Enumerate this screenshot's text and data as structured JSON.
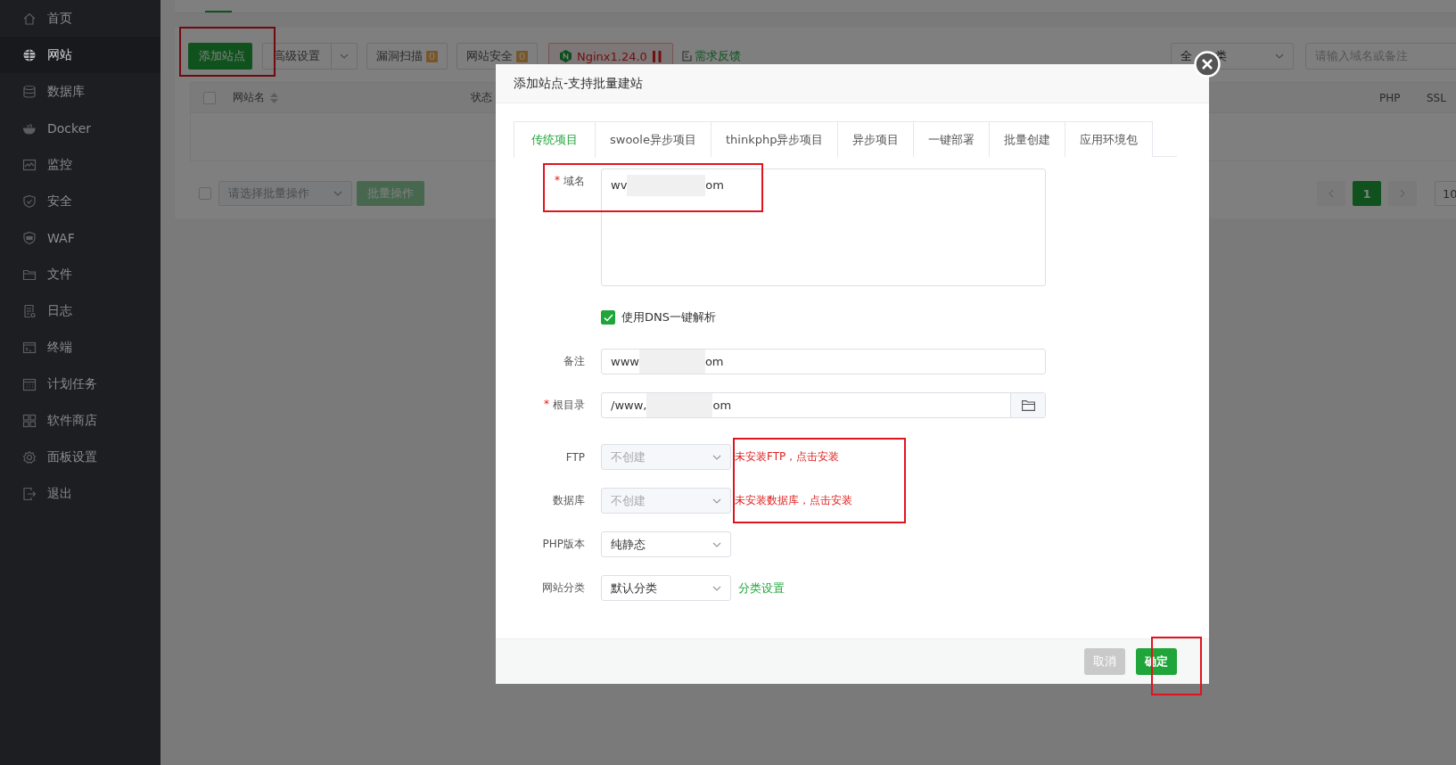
{
  "sidebar": {
    "items": [
      {
        "label": "首页",
        "selected": false
      },
      {
        "label": "网站",
        "selected": true
      },
      {
        "label": "数据库",
        "selected": false
      },
      {
        "label": "Docker",
        "selected": false
      },
      {
        "label": "监控",
        "selected": false
      },
      {
        "label": "安全",
        "selected": false
      },
      {
        "label": "WAF",
        "selected": false
      },
      {
        "label": "文件",
        "selected": false
      },
      {
        "label": "日志",
        "selected": false
      },
      {
        "label": "终端",
        "selected": false
      },
      {
        "label": "计划任务",
        "selected": false
      },
      {
        "label": "软件商店",
        "selected": false
      },
      {
        "label": "面板设置",
        "selected": false
      },
      {
        "label": "退出",
        "selected": false
      }
    ]
  },
  "toolbar": {
    "buttons": [
      {
        "kind": "primary",
        "label": "添加站点",
        "highlighted": true
      },
      {
        "kind": "split",
        "label": "高级设置"
      },
      {
        "kind": "count",
        "label": "漏洞扫描",
        "count": "0"
      },
      {
        "kind": "count",
        "label": "网站安全",
        "count": "0"
      },
      {
        "kind": "server",
        "label": "Nginx1.24.0"
      },
      {
        "kind": "link",
        "label": "需求反馈"
      }
    ],
    "category_filter": {
      "visible_start": "全",
      "visible_end": "类"
    },
    "search": {
      "placeholder": "请输入域名或备注"
    }
  },
  "table": {
    "select_all": {
      "checked": false
    },
    "columns": [
      {
        "label": "网站名",
        "sortable": true
      },
      {
        "label": "状态",
        "sortable": false
      },
      {
        "label": "PHP",
        "sortable": false
      },
      {
        "label": "SSL",
        "sortable": false
      }
    ]
  },
  "batch": {
    "checked": false,
    "placeholder": "请选择批量操作",
    "button": "批量操作"
  },
  "pagination": {
    "pages": [
      {
        "label": "1",
        "selected": true
      }
    ],
    "page_size": "10"
  },
  "dialog": {
    "title": "添加站点-支持批量建站",
    "tabs": [
      {
        "label": "传统项目",
        "selected": true
      },
      {
        "label": "swoole异步项目",
        "selected": false
      },
      {
        "label": "thinkphp异步项目",
        "selected": false
      },
      {
        "label": "异步项目",
        "selected": false
      },
      {
        "label": "一键部署",
        "selected": false
      },
      {
        "label": "批量创建",
        "selected": false
      },
      {
        "label": "应用环境包",
        "selected": false
      }
    ],
    "fields": [
      {
        "kind": "textarea",
        "label": "域名",
        "required_mark": "*",
        "value_head": "wv",
        "value_tail": "om",
        "highlighted": true
      },
      {
        "kind": "checkbox",
        "label": "使用DNS一键解析",
        "checked": true
      },
      {
        "kind": "input",
        "label": "备注",
        "value_head": "www",
        "value_tail": "om"
      },
      {
        "kind": "path",
        "label": "根目录",
        "required_mark": "*",
        "value_head": "/www,",
        "value_tail": "om"
      },
      {
        "kind": "select",
        "label": "FTP",
        "value": "不创建",
        "disabled": true,
        "notice": "未安装FTP，点击安装",
        "highlighted": true
      },
      {
        "kind": "select",
        "label": "数据库",
        "value": "不创建",
        "disabled": true,
        "notice": "未安装数据库，点击安装",
        "highlighted": true
      },
      {
        "kind": "select",
        "label": "PHP版本",
        "value": "纯静态",
        "disabled": false
      },
      {
        "kind": "select",
        "label": "网站分类",
        "value": "默认分类",
        "disabled": false,
        "link": "分类设置"
      }
    ],
    "buttons": [
      {
        "kind": "cancel",
        "label": "取消"
      },
      {
        "kind": "confirm",
        "label": "确定",
        "highlighted": true
      }
    ]
  }
}
